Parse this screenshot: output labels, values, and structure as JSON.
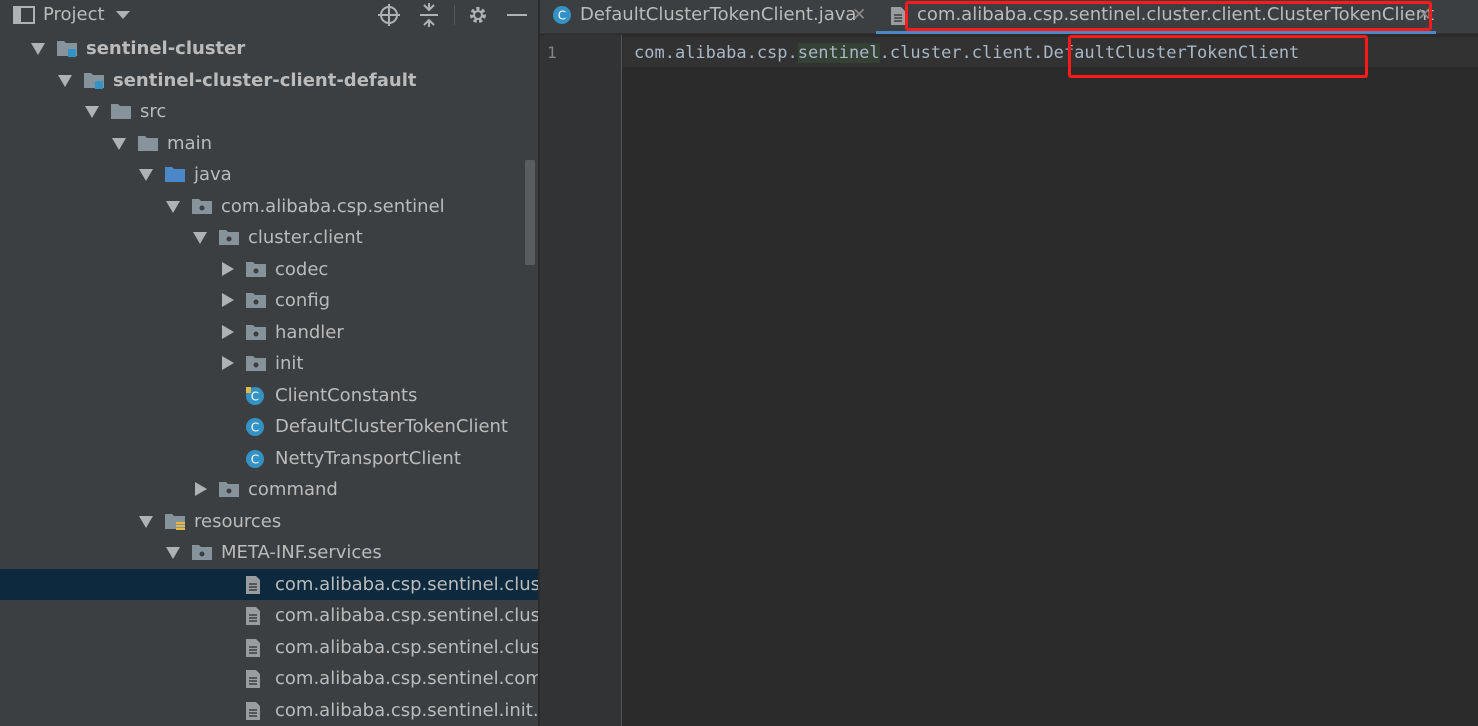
{
  "project_panel": {
    "title": "Project",
    "tree": [
      {
        "label": "sentinel-cluster",
        "bold": true,
        "indent": 0,
        "arrow": "down",
        "icon": "module-folder-icon"
      },
      {
        "label": "sentinel-cluster-client-default",
        "bold": true,
        "indent": 1,
        "arrow": "down",
        "icon": "module-folder-icon"
      },
      {
        "label": "src",
        "indent": 2,
        "arrow": "down",
        "icon": "folder-icon"
      },
      {
        "label": "main",
        "indent": 3,
        "arrow": "down",
        "icon": "folder-icon"
      },
      {
        "label": "java",
        "indent": 4,
        "arrow": "down",
        "icon": "source-folder-icon"
      },
      {
        "label": "com.alibaba.csp.sentinel",
        "indent": 5,
        "arrow": "down",
        "icon": "package-icon"
      },
      {
        "label": "cluster.client",
        "indent": 6,
        "arrow": "down",
        "icon": "package-icon"
      },
      {
        "label": "codec",
        "indent": 7,
        "arrow": "right",
        "icon": "package-icon"
      },
      {
        "label": "config",
        "indent": 7,
        "arrow": "right",
        "icon": "package-icon"
      },
      {
        "label": "handler",
        "indent": 7,
        "arrow": "right",
        "icon": "package-icon"
      },
      {
        "label": "init",
        "indent": 7,
        "arrow": "right",
        "icon": "package-icon"
      },
      {
        "label": "ClientConstants",
        "indent": 7,
        "arrow": "none",
        "icon": "class-lock-icon"
      },
      {
        "label": "DefaultClusterTokenClient",
        "indent": 7,
        "arrow": "none",
        "icon": "class-icon"
      },
      {
        "label": "NettyTransportClient",
        "indent": 7,
        "arrow": "none",
        "icon": "class-icon"
      },
      {
        "label": "command",
        "indent": 6,
        "arrow": "right",
        "icon": "package-icon"
      },
      {
        "label": "resources",
        "indent": 4,
        "arrow": "down",
        "icon": "resources-folder-icon"
      },
      {
        "label": "META-INF.services",
        "indent": 5,
        "arrow": "down",
        "icon": "package-icon"
      },
      {
        "label": "com.alibaba.csp.sentinel.cluster.cli",
        "indent": 7,
        "arrow": "none",
        "icon": "text-file-icon",
        "selected": true
      },
      {
        "label": "com.alibaba.csp.sentinel.cluster.co",
        "indent": 7,
        "arrow": "none",
        "icon": "text-file-icon"
      },
      {
        "label": "com.alibaba.csp.sentinel.cluster.co",
        "indent": 7,
        "arrow": "none",
        "icon": "text-file-icon"
      },
      {
        "label": "com.alibaba.csp.sentinel.comman",
        "indent": 7,
        "arrow": "none",
        "icon": "text-file-icon"
      },
      {
        "label": "com.alibaba.csp.sentinel.init.InitFu",
        "indent": 7,
        "arrow": "none",
        "icon": "text-file-icon"
      }
    ]
  },
  "editor": {
    "tabs": [
      {
        "label": "DefaultClusterTokenClient.java",
        "icon": "class-icon",
        "active": false
      },
      {
        "label": "com.alibaba.csp.sentinel.cluster.client.ClusterTokenClient",
        "icon": "text-file-icon",
        "active": true
      }
    ],
    "line_number": "1",
    "code": {
      "prefix": "com.alibaba.csp.",
      "highlighted": "sentinel",
      "middle": ".cluster.client.",
      "class_name": "DefaultClusterTokenClient"
    }
  },
  "colors": {
    "highlight_box": "#ff1a1a",
    "selection": "#0d293e",
    "class_icon": "#3592c4",
    "folder": "#87939a",
    "source_folder": "#4a88c7"
  }
}
